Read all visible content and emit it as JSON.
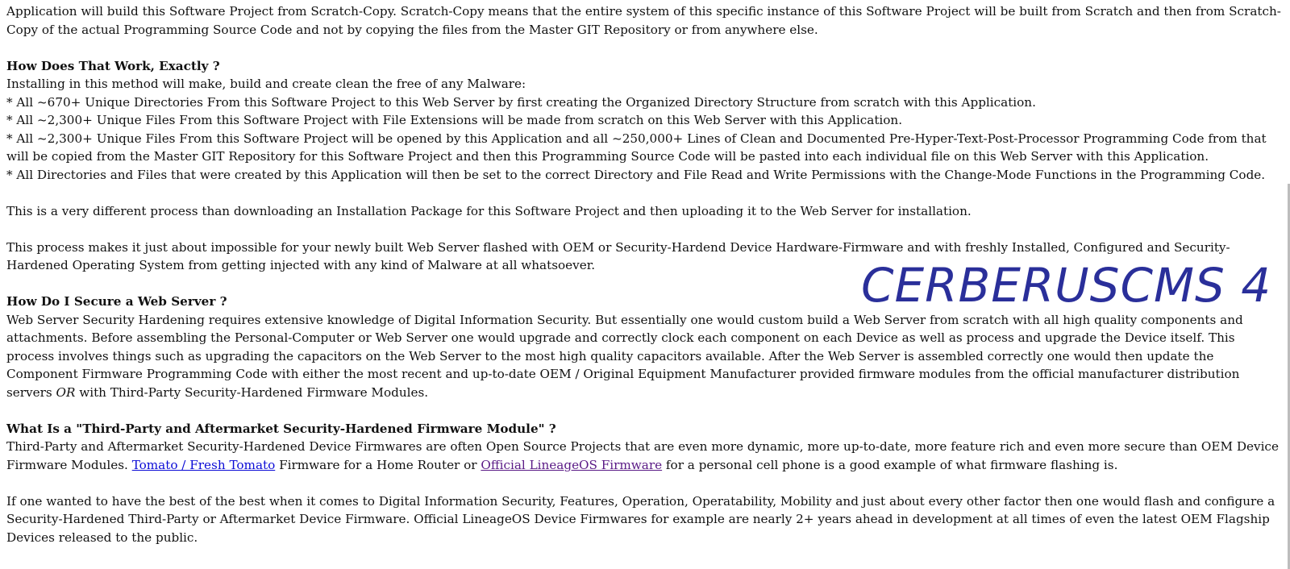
{
  "logo": {
    "text": "CERBERUSCMS 4",
    "color": "#2a2f9a"
  },
  "intro": {
    "text": "Application will build this Software Project from Scratch-Copy. Scratch-Copy means that the entire system of this specific instance of this Software Project will be built from Scratch and then from Scratch-Copy of the actual Programming Source Code and not by copying the files from the Master GIT Repository or from anywhere else."
  },
  "how_it_works": {
    "heading": "How Does That Work, Exactly ?",
    "lead": "Installing in this method will make, build and create clean the free of any Malware:",
    "bullets": [
      "* All ~670+ Unique Directories From this Software Project to this Web Server by first creating the Organized Directory Structure from scratch with this Application.",
      "* All ~2,300+ Unique Files From this Software Project with File Extensions will be made from scratch on this Web Server with this Application.",
      "* All ~2,300+ Unique Files From this Software Project will be opened by this Application and all ~250,000+ Lines of Clean and Documented Pre-Hyper-Text-Post-Processor Programming Code from that will be copied from the Master GIT Repository for this Software Project and then this Programming Source Code will be pasted into each individual file on this Web Server with this Application.",
      "* All Directories and Files that were created by this Application will then be set to the correct Directory and File Read and Write Permissions with the Change-Mode Functions in the Programming Code."
    ],
    "difference": "This is a very different process than downloading an Installation Package for this Software Project and then uploading it to the Web Server for installation.",
    "impossible": "This process makes it just about impossible for your newly built Web Server flashed with OEM or Security-Hardend Device Hardware-Firmware and with freshly Installed, Configured and Security-Hardened Operating System from getting injected with any kind of Malware at all whatsoever."
  },
  "secure": {
    "heading": "How Do I Secure a Web Server ?",
    "text_before": "Web Server Security Hardening requires extensive knowledge of Digital Information Security. But essentially one would custom build a Web Server from scratch with all high quality components and attachments. Before assembling the Personal-Computer or Web Server one would upgrade and correctly clock each component on each Device as well as process and upgrade the Device itself. This process involves things such as upgrading the capacitors on the Web Server to the most high quality capacitors available. After the Web Server is assembled correctly one would then update the Component Firmware Programming Code with either the most recent and up-to-date OEM / Original Equipment Manufacturer provided firmware modules from the official manufacturer distribution servers ",
    "emphasis": "OR",
    "text_after": " with Third-Party Security-Hardened Firmware Modules."
  },
  "firmware": {
    "heading": "What Is a \"Third-Party and Aftermarket Security-Hardened Firmware Module\" ?",
    "text_before": "Third-Party and Aftermarket Security-Hardened Device Firmwares are often Open Source Projects that are even more dynamic, more up-to-date, more feature rich and even more secure than OEM Device Firmware Modules. ",
    "link1": "Tomato / Fresh Tomato",
    "text_middle": " Firmware for a Home Router or ",
    "link2": "Official LineageOS Firmware",
    "text_after": " for a personal cell phone is a good example of what firmware flashing is.",
    "best": "If one wanted to have the best of the best when it comes to Digital Information Security, Features, Operation, Operatability, Mobility and just about every other factor then one would flash and configure a Security-Hardened Third-Party or Aftermarket Device Firmware. Official LineageOS Device Firmwares for example are nearly 2+ years ahead in development at all times of even the latest OEM Flagship Devices released to the public."
  },
  "colors": {
    "link": "#0b0bd6",
    "visited_link": "#5a1a86",
    "text": "#111111"
  }
}
